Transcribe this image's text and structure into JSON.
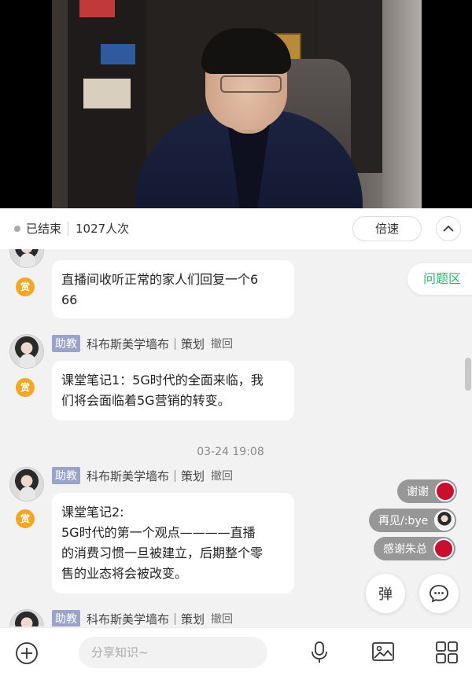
{
  "status": {
    "state": "已结束",
    "viewers": "1027人次",
    "speed_label": "倍速"
  },
  "faq_tab": "问题区",
  "messages": [
    {
      "reward_label": "赏",
      "text": "直播间收听正常的家人们回复一个6\n66"
    },
    {
      "role": "助教",
      "name": "科布斯美学墙布｜策划",
      "revoke": "撤回",
      "reward_label": "赏",
      "text": "课堂笔记1：5G时代的全面来临，我\n们将会面临着5G营销的转变。"
    },
    {
      "time": "03-24 19:08"
    },
    {
      "role": "助教",
      "name": "科布斯美学墙布｜策划",
      "revoke": "撤回",
      "reward_label": "赏",
      "text": "课堂笔记2:\n5G时代的第一个观点————直播\n的消费习惯一旦被建立，后期整个零\n售的业态将会被改变。"
    },
    {
      "role": "助教",
      "name": "科布斯美学墙布｜策划",
      "revoke": "撤回"
    }
  ],
  "reactions": [
    {
      "text": "谢谢"
    },
    {
      "text": "再见/:bye"
    },
    {
      "text": "感谢朱总"
    }
  ],
  "danmu_label": "弹",
  "toolbar": {
    "input_placeholder": "分享知识~"
  },
  "colors": {
    "accent_green": "#2bb673",
    "reward_orange": "#f5a623",
    "role_tag": "#9ba3c9"
  }
}
